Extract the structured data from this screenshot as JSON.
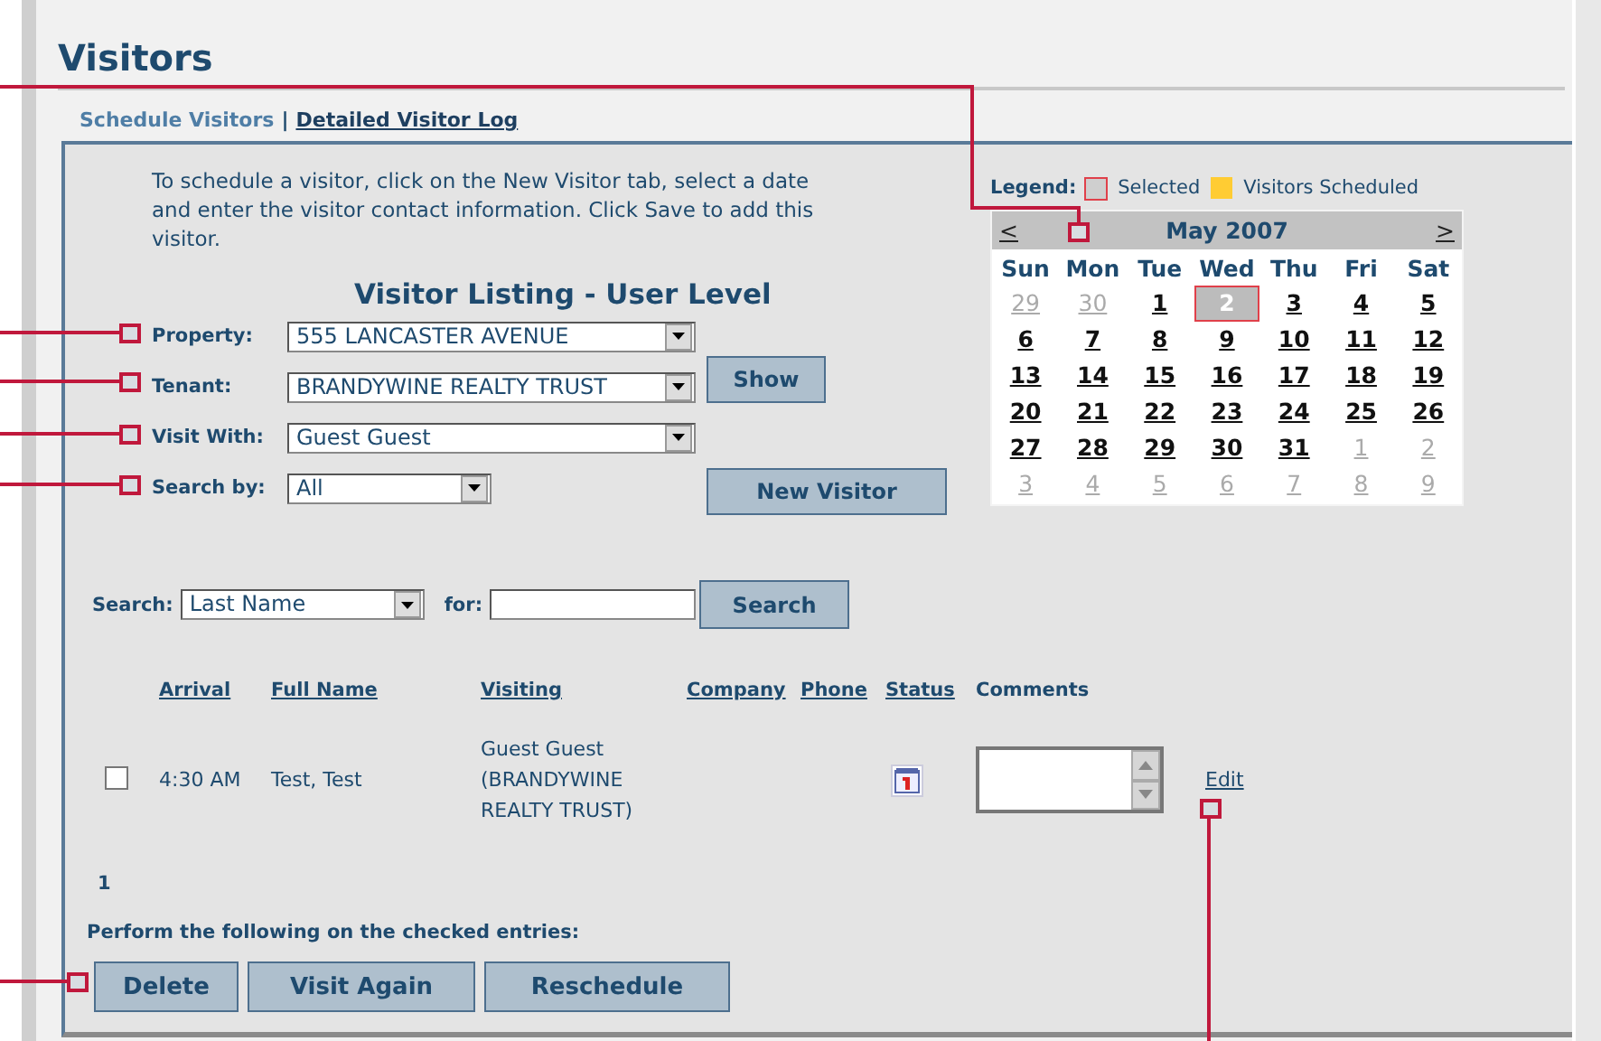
{
  "page": {
    "title": "Visitors"
  },
  "nav_links": [
    {
      "label": "Schedule Visitors",
      "selected": true
    },
    {
      "label": "Detailed Visitor Log",
      "selected": false
    }
  ],
  "nav_separator": "|",
  "instructions": "To schedule a visitor, click on the New Visitor tab, select a date and enter the visitor contact information. Click Save to add this visitor.",
  "listing_title": "Visitor Listing - User Level",
  "filters": [
    {
      "label": "Property:",
      "value": "555 LANCASTER AVENUE",
      "kind": "wide"
    },
    {
      "label": "Tenant:",
      "value": "BRANDYWINE REALTY TRUST",
      "kind": "wide"
    },
    {
      "label": "Visit With:",
      "value": "Guest Guest",
      "kind": "wide"
    },
    {
      "label": "Search by:",
      "value": "All",
      "kind": "narrow"
    }
  ],
  "show_button": "Show",
  "new_visitor_button": "New Visitor",
  "legend": {
    "label": "Legend:",
    "items": [
      {
        "label": "Selected",
        "kind": "selected"
      },
      {
        "label": "Visitors Scheduled",
        "kind": "scheduled",
        "color": "#ffcc33"
      }
    ]
  },
  "calendar": {
    "prev": "<",
    "month": "May 2007",
    "next": ">",
    "weekdays": [
      "Sun",
      "Mon",
      "Tue",
      "Wed",
      "Thu",
      "Fri",
      "Sat"
    ],
    "weeks": [
      [
        {
          "day": "29",
          "in_month": false,
          "selected": false
        },
        {
          "day": "30",
          "in_month": false,
          "selected": false
        },
        {
          "day": "1",
          "in_month": true,
          "selected": false
        },
        {
          "day": "2",
          "in_month": true,
          "selected": true
        },
        {
          "day": "3",
          "in_month": true,
          "selected": false
        },
        {
          "day": "4",
          "in_month": true,
          "selected": false
        },
        {
          "day": "5",
          "in_month": true,
          "selected": false
        }
      ],
      [
        {
          "day": "6",
          "in_month": true,
          "selected": false
        },
        {
          "day": "7",
          "in_month": true,
          "selected": false
        },
        {
          "day": "8",
          "in_month": true,
          "selected": false
        },
        {
          "day": "9",
          "in_month": true,
          "selected": false
        },
        {
          "day": "10",
          "in_month": true,
          "selected": false
        },
        {
          "day": "11",
          "in_month": true,
          "selected": false
        },
        {
          "day": "12",
          "in_month": true,
          "selected": false
        }
      ],
      [
        {
          "day": "13",
          "in_month": true,
          "selected": false
        },
        {
          "day": "14",
          "in_month": true,
          "selected": false
        },
        {
          "day": "15",
          "in_month": true,
          "selected": false
        },
        {
          "day": "16",
          "in_month": true,
          "selected": false
        },
        {
          "day": "17",
          "in_month": true,
          "selected": false
        },
        {
          "day": "18",
          "in_month": true,
          "selected": false
        },
        {
          "day": "19",
          "in_month": true,
          "selected": false
        }
      ],
      [
        {
          "day": "20",
          "in_month": true,
          "selected": false
        },
        {
          "day": "21",
          "in_month": true,
          "selected": false
        },
        {
          "day": "22",
          "in_month": true,
          "selected": false
        },
        {
          "day": "23",
          "in_month": true,
          "selected": false
        },
        {
          "day": "24",
          "in_month": true,
          "selected": false
        },
        {
          "day": "25",
          "in_month": true,
          "selected": false
        },
        {
          "day": "26",
          "in_month": true,
          "selected": false
        }
      ],
      [
        {
          "day": "27",
          "in_month": true,
          "selected": false
        },
        {
          "day": "28",
          "in_month": true,
          "selected": false
        },
        {
          "day": "29",
          "in_month": true,
          "selected": false
        },
        {
          "day": "30",
          "in_month": true,
          "selected": false
        },
        {
          "day": "31",
          "in_month": true,
          "selected": false
        },
        {
          "day": "1",
          "in_month": false,
          "selected": false
        },
        {
          "day": "2",
          "in_month": false,
          "selected": false
        }
      ],
      [
        {
          "day": "3",
          "in_month": false,
          "selected": false
        },
        {
          "day": "4",
          "in_month": false,
          "selected": false
        },
        {
          "day": "5",
          "in_month": false,
          "selected": false
        },
        {
          "day": "6",
          "in_month": false,
          "selected": false
        },
        {
          "day": "7",
          "in_month": false,
          "selected": false
        },
        {
          "day": "8",
          "in_month": false,
          "selected": false
        },
        {
          "day": "9",
          "in_month": false,
          "selected": false
        }
      ]
    ]
  },
  "search": {
    "label": "Search:",
    "field": "Last Name",
    "for_label": "for:",
    "button": "Search"
  },
  "table": {
    "columns": [
      {
        "label": "Arrival",
        "sortable": true
      },
      {
        "label": "Full Name",
        "sortable": true
      },
      {
        "label": "Visiting",
        "sortable": true
      },
      {
        "label": "Company",
        "sortable": true
      },
      {
        "label": "Phone",
        "sortable": true
      },
      {
        "label": "Status",
        "sortable": true
      },
      {
        "label": "Comments",
        "sortable": false
      }
    ],
    "rows": [
      {
        "checked": false,
        "arrival": "4:30 AM",
        "full_name": "Test, Test",
        "visiting": "Guest Guest (BRANDYWINE REALTY TRUST)",
        "edit": "Edit"
      }
    ]
  },
  "count": "1",
  "actions_label": "Perform the following on the checked entries:",
  "actions": [
    "Delete",
    "Visit Again",
    "Reschedule"
  ]
}
